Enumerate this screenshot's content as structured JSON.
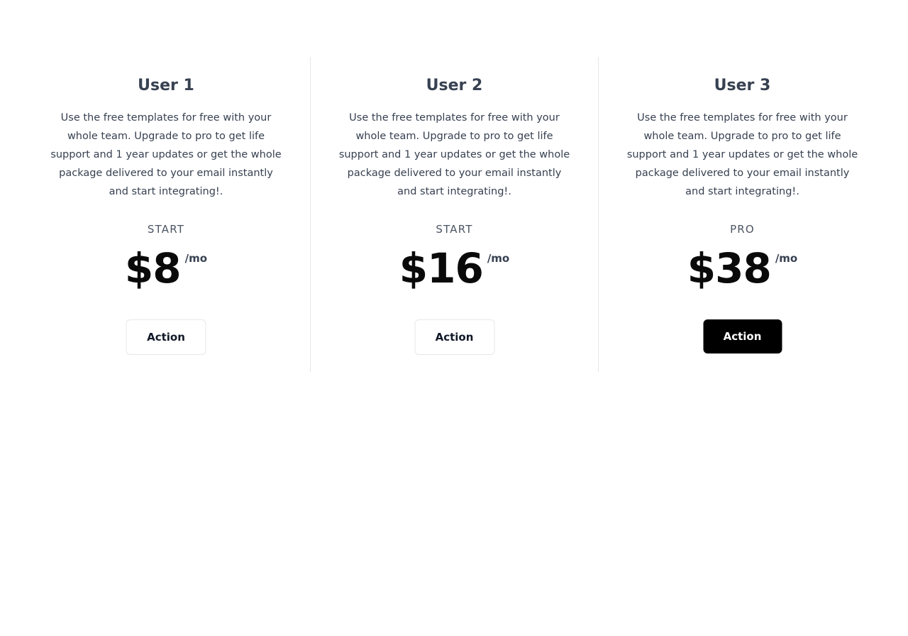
{
  "plans": [
    {
      "title": "User 1",
      "description": "Use the free templates for free with your whole team. Upgrade to pro to get life support and 1 year updates or get the whole package delivered to your email instantly and start integrating!.",
      "tier": "START",
      "price": "$8",
      "period": "/mo",
      "action_label": "Action",
      "action_style": "outline"
    },
    {
      "title": "User 2",
      "description": "Use the free templates for free with your whole team. Upgrade to pro to get life support and 1 year updates or get the whole package delivered to your email instantly and start integrating!.",
      "tier": "START",
      "price": "$16",
      "period": "/mo",
      "action_label": "Action",
      "action_style": "outline"
    },
    {
      "title": "User 3",
      "description": "Use the free templates for free with your whole team. Upgrade to pro to get life support and 1 year updates or get the whole package delivered to your email instantly and start integrating!.",
      "tier": "PRO",
      "price": "$38",
      "period": "/mo",
      "action_label": "Action",
      "action_style": "primary"
    }
  ],
  "colors": {
    "text": "#374151",
    "price": "#0a0a0a",
    "primary_button_bg": "#000000",
    "primary_button_text": "#ffffff",
    "divider": "#e5e7eb"
  }
}
